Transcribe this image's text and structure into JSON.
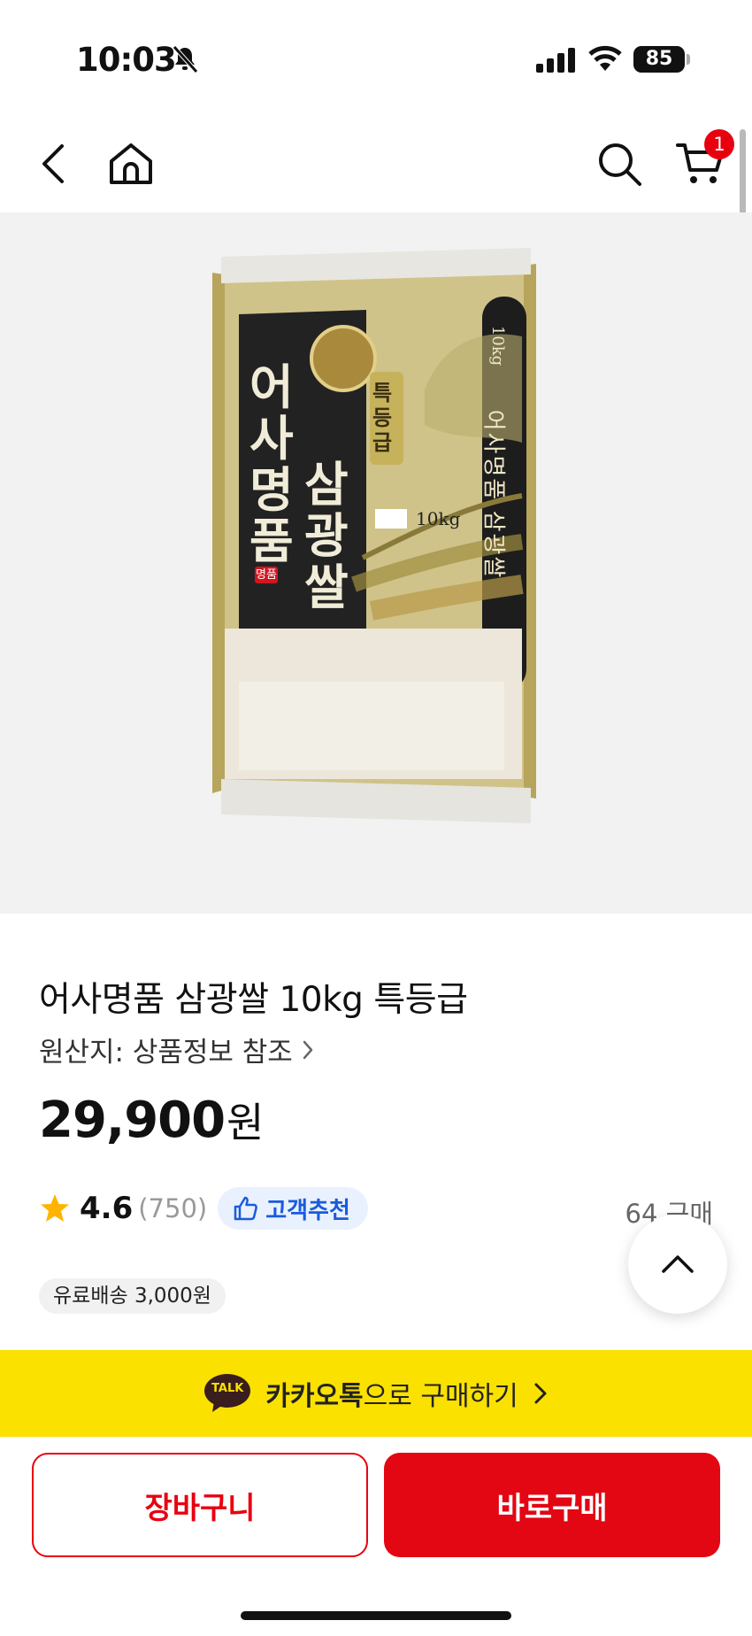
{
  "status_bar": {
    "time": "10:03",
    "battery": "85"
  },
  "nav": {
    "cart_count": "1"
  },
  "product_image": {
    "bag_text_main_left": "어사명품",
    "bag_text_main_right": "삼광쌀",
    "bag_badge": "특등급",
    "bag_weight": "10kg",
    "bag_seal": "명품",
    "bag_side_text": "어사명품 삼광쌀",
    "bag_side_weight": "10kg"
  },
  "product": {
    "title": "어사명품 삼광쌀 10kg 특등급",
    "origin": "원산지: 상품정보 참조",
    "price": "29,900",
    "price_unit": "원",
    "rating": "4.6",
    "review_count": "(750)",
    "recommend_badge": "고객추천",
    "purchase_count": "64 구매",
    "shipping": "유료배송 3,000원"
  },
  "kakao": {
    "brand": "카카오톡",
    "suffix": "으로 구매하기",
    "talk_label": "TALK"
  },
  "actions": {
    "cart": "장바구니",
    "buy_now": "바로구매"
  },
  "colors": {
    "accent_red": "#e30613",
    "kakao_yellow": "#fae100",
    "recommend_blue": "#1a5bdc"
  }
}
